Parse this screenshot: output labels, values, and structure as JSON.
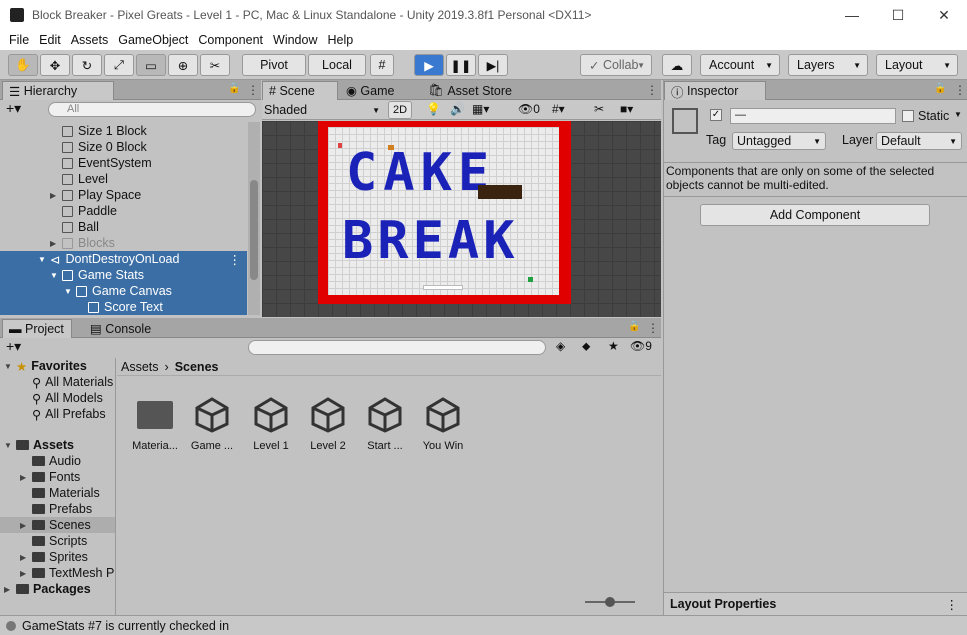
{
  "window": {
    "title": "Block Breaker - Pixel Greats - Level 1 - PC, Mac & Linux Standalone - Unity 2019.3.8f1 Personal <DX11>",
    "minimize": "—",
    "maximize": "☐",
    "close": "✕"
  },
  "menu": [
    "File",
    "Edit",
    "Assets",
    "GameObject",
    "Component",
    "Window",
    "Help"
  ],
  "toolbar": {
    "pivot": "Pivot",
    "local": "Local",
    "collab": "Collab",
    "account": "Account",
    "layers": "Layers",
    "layout": "Layout"
  },
  "hierarchy": {
    "tab": "Hierarchy",
    "search_placeholder": "All",
    "items": [
      {
        "label": "Size 1 Block"
      },
      {
        "label": "Size 0 Block"
      },
      {
        "label": "EventSystem"
      },
      {
        "label": "Level"
      },
      {
        "label": "Play Space"
      },
      {
        "label": "Paddle"
      },
      {
        "label": "Ball"
      },
      {
        "label": "Blocks"
      },
      {
        "label": "DontDestroyOnLoad"
      },
      {
        "label": "Game Stats"
      },
      {
        "label": "Game Canvas"
      },
      {
        "label": "Score Text"
      }
    ]
  },
  "scene": {
    "tabs": [
      "Scene",
      "Game",
      "Asset Store"
    ],
    "shading": "Shaded",
    "mode2d": "2D",
    "hidden_count": "0",
    "canvas_text_1": "CAKE",
    "canvas_text_2": "BREAK"
  },
  "inspector": {
    "tab": "Inspector",
    "name_value": "—",
    "static_label": "Static",
    "tag_label": "Tag",
    "tag_value": "Untagged",
    "layer_label": "Layer",
    "layer_value": "Default",
    "message": "Components that are only on some of the selected objects cannot be multi-edited.",
    "add_component": "Add Component",
    "layout_props": "Layout Properties"
  },
  "project": {
    "tabs": [
      "Project",
      "Console"
    ],
    "hidden_count": "9",
    "breadcrumb_root": "Assets",
    "breadcrumb_leaf": "Scenes",
    "favorites": {
      "label": "Favorites",
      "items": [
        "All Materials",
        "All Models",
        "All Prefabs"
      ]
    },
    "assets": {
      "label": "Assets",
      "items": [
        "Audio",
        "Fonts",
        "Materials",
        "Prefabs",
        "Scenes",
        "Scripts",
        "Sprites",
        "TextMesh P"
      ]
    },
    "packages": "Packages",
    "files": [
      "Materia...",
      "Game ...",
      "Level 1",
      "Level 2",
      "Start ...",
      "You Win"
    ]
  },
  "status": {
    "text": "GameStats #7 is currently checked in"
  },
  "colors": {
    "selection": "#3b6ea5",
    "play": "#3a79d0",
    "canvas_border": "#e00000",
    "letters": "#1a22b8"
  }
}
